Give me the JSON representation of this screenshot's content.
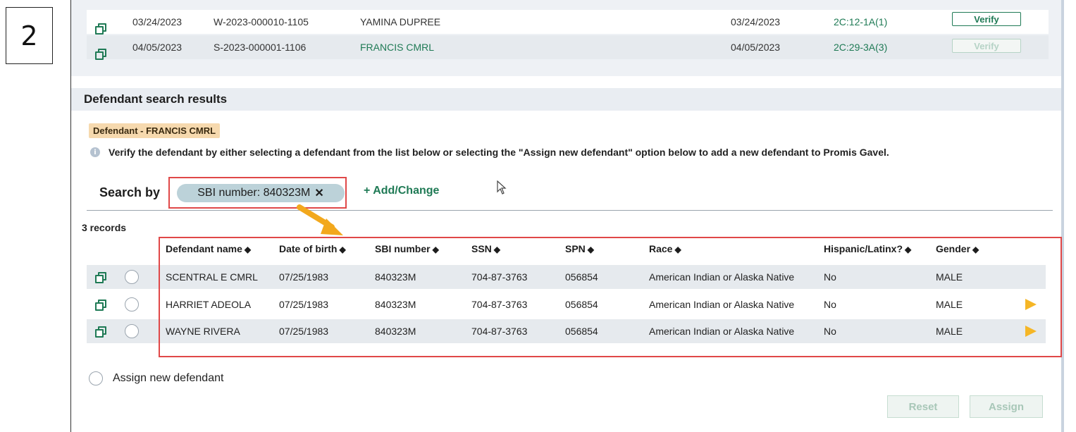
{
  "step_number": "2",
  "top_rows": [
    {
      "date1": "03/24/2023",
      "case": "W-2023-000010-1105",
      "name": "YAMINA DUPREE",
      "date2": "03/24/2023",
      "code": "2C:12-1A(1)",
      "verify": "Verify",
      "verify_enabled": true
    },
    {
      "date1": "04/05/2023",
      "case": "S-2023-000001-1106",
      "name": "FRANCIS CMRL",
      "date2": "04/05/2023",
      "code": "2C:29-3A(3)",
      "verify": "Verify",
      "verify_enabled": false
    }
  ],
  "section": {
    "title": "Defendant search results",
    "badge": "Defendant - FRANCIS CMRL",
    "info": "Verify the defendant by either selecting a defendant from the list below or selecting the \"Assign new defendant\" option below to add a new defendant to Promis Gavel."
  },
  "search": {
    "label": "Search by",
    "chip": "SBI number:  840323M",
    "chip_close": "✕",
    "add_change": "+ Add/Change"
  },
  "records_count": "3 records",
  "table": {
    "headers": [
      "Defendant name",
      "Date of birth",
      "SBI number",
      "SSN",
      "SPN",
      "Race",
      "Hispanic/Latinx?",
      "Gender"
    ],
    "rows": [
      {
        "name": "SCENTRAL E CMRL",
        "dob": "07/25/1983",
        "sbi": "840323M",
        "ssn": "704-87-3763",
        "spn": "056854",
        "race": "American Indian or Alaska Native",
        "hispanic": "No",
        "gender": "MALE",
        "flag": false
      },
      {
        "name": "HARRIET ADEOLA",
        "dob": "07/25/1983",
        "sbi": "840323M",
        "ssn": "704-87-3763",
        "spn": "056854",
        "race": "American Indian or Alaska Native",
        "hispanic": "No",
        "gender": "MALE",
        "flag": true
      },
      {
        "name": "WAYNE RIVERA",
        "dob": "07/25/1983",
        "sbi": "840323M",
        "ssn": "704-87-3763",
        "spn": "056854",
        "race": "American Indian or Alaska Native",
        "hispanic": "No",
        "gender": "MALE",
        "flag": true
      }
    ]
  },
  "assign_new_label": "Assign new defendant",
  "buttons": {
    "reset": "Reset",
    "assign": "Assign"
  },
  "colors": {
    "accent": "#1f7a55",
    "highlight": "#e04848",
    "badge": "#f6d9ae",
    "flag": "#f5b626",
    "arrow": "#f2a81d"
  },
  "icons": {
    "copy": "copy-icon",
    "flag": "flag-icon",
    "info": "info-icon",
    "sort": "sort-icon",
    "cursor": "mouse-cursor-icon"
  }
}
